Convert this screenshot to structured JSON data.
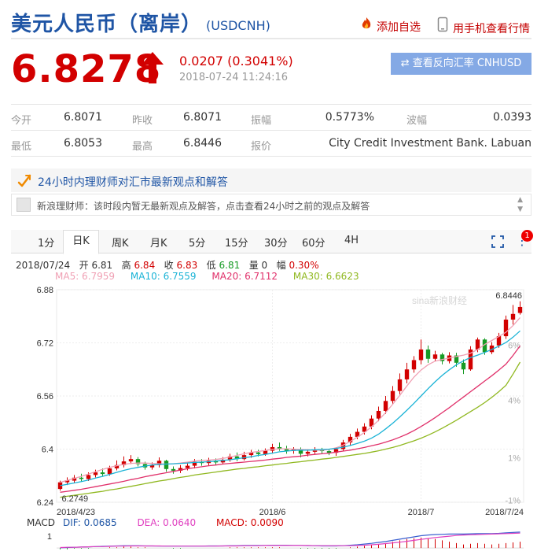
{
  "header": {
    "title": "美元人民币（离岸）",
    "symbol": "(USDCNH)",
    "add_favorite": "添加自选",
    "mobile_view": "用手机查看行情"
  },
  "quote": {
    "price": "6.8278",
    "change": "0.0207 (0.3041%)",
    "time": "2018-07-24 11:24:16",
    "reverse_button": "⇄ 查看反向汇率 CNHUSD"
  },
  "stats": {
    "open_label": "今开",
    "open": "6.8071",
    "prev_close_label": "昨收",
    "prev_close": "6.8071",
    "amplitude_label": "振幅",
    "amplitude": "0.5773%",
    "wave_label": "波幅",
    "wave": "0.0393",
    "low_label": "最低",
    "low": "6.8053",
    "high_label": "最高",
    "high": "6.8446",
    "quote_label": "报价",
    "quote_source": "City Credit Investment Bank. Labuan"
  },
  "advisor": {
    "headline": "24小时内理财师对汇市最新观点和解答",
    "message": "新浪理财师：该时段内暂无最新观点及解答，点击查看24小时之前的观点及解答"
  },
  "tabs": [
    "1分",
    "日K",
    "周K",
    "月K",
    "5分",
    "15分",
    "30分",
    "60分",
    "4H"
  ],
  "active_tab": "日K",
  "notification_count": "1",
  "bar_info": {
    "date": "2018/07/24",
    "open_label": "开",
    "open": "6.81",
    "high_label": "高",
    "high": "6.84",
    "close_label": "收",
    "close": "6.83",
    "low_label": "低",
    "low": "6.81",
    "volume_label": "量",
    "volume": "0",
    "range_label": "幅",
    "range": "0.30%"
  },
  "ma": {
    "ma5": "MA5: 6.7959",
    "ma10": "MA10: 6.7559",
    "ma20": "MA20: 6.7112",
    "ma30": "MA30: 6.6623"
  },
  "macd": {
    "label": "MACD",
    "dif": "DIF: 0.0685",
    "dea": "DEA: 0.0640",
    "macd": "MACD: 0.0090",
    "axis_label": "1"
  },
  "watermark": "sina新浪财经",
  "colors": {
    "up": "#d20000",
    "down": "#179b25",
    "ma5": "#f0a0b4",
    "ma10": "#1ab3d6",
    "ma20": "#e0306a",
    "ma30": "#90b820",
    "brand": "#1f55a5"
  },
  "chart_data": {
    "type": "candlestick",
    "x_tick_labels": [
      "2018/4/23",
      "2018/6",
      "2018/7",
      "2018/7/24"
    ],
    "y_tick_labels": [
      "6.88",
      "6.72",
      "6.56",
      "6.4",
      "6.24"
    ],
    "right_axis_labels": [
      "6%",
      "4%",
      "1%",
      "-1%"
    ],
    "ylim": [
      6.24,
      6.88
    ],
    "max_annotation": "6.8446",
    "min_annotation": "6.2749",
    "grid": true,
    "series": [
      {
        "name": "MA5",
        "values": [
          6.3,
          6.306,
          6.312,
          6.318,
          6.325,
          6.332,
          6.339,
          6.345,
          6.35,
          6.354,
          6.357,
          6.358,
          6.358,
          6.357,
          6.356,
          6.355,
          6.356,
          6.358,
          6.361,
          6.364,
          6.366,
          6.367,
          6.369,
          6.372,
          6.376,
          6.381,
          6.386,
          6.39,
          6.393,
          6.396,
          6.399,
          6.401,
          6.401,
          6.4,
          6.399,
          6.398,
          6.397,
          6.397,
          6.399,
          6.404,
          6.412,
          6.423,
          6.436,
          6.45,
          6.467,
          6.487,
          6.51,
          6.535,
          6.562,
          6.59,
          6.617,
          6.638,
          6.654,
          6.665,
          6.67,
          6.674,
          6.679,
          6.683,
          6.689,
          6.7,
          6.715,
          6.727,
          6.739,
          6.752,
          6.772,
          6.796
        ]
      },
      {
        "name": "MA10",
        "values": [
          6.29,
          6.294,
          6.298,
          6.302,
          6.307,
          6.313,
          6.318,
          6.324,
          6.33,
          6.336,
          6.341,
          6.345,
          6.349,
          6.352,
          6.354,
          6.355,
          6.356,
          6.357,
          6.358,
          6.36,
          6.361,
          6.362,
          6.364,
          6.366,
          6.368,
          6.371,
          6.374,
          6.377,
          6.381,
          6.384,
          6.388,
          6.392,
          6.394,
          6.396,
          6.397,
          6.397,
          6.398,
          6.399,
          6.4,
          6.402,
          6.406,
          6.411,
          6.417,
          6.424,
          6.433,
          6.445,
          6.461,
          6.478,
          6.497,
          6.517,
          6.538,
          6.56,
          6.582,
          6.603,
          6.622,
          6.639,
          6.654,
          6.666,
          6.676,
          6.683,
          6.691,
          6.7,
          6.71,
          6.721,
          6.737,
          6.756
        ]
      },
      {
        "name": "MA20",
        "values": [
          6.27,
          6.273,
          6.276,
          6.279,
          6.283,
          6.287,
          6.291,
          6.295,
          6.299,
          6.303,
          6.308,
          6.312,
          6.317,
          6.321,
          6.325,
          6.329,
          6.333,
          6.337,
          6.341,
          6.344,
          6.347,
          6.35,
          6.352,
          6.355,
          6.357,
          6.359,
          6.361,
          6.363,
          6.365,
          6.367,
          6.37,
          6.372,
          6.375,
          6.377,
          6.379,
          6.382,
          6.384,
          6.386,
          6.388,
          6.391,
          6.394,
          6.397,
          6.401,
          6.405,
          6.41,
          6.415,
          6.421,
          6.428,
          6.436,
          6.445,
          6.456,
          6.468,
          6.481,
          6.495,
          6.51,
          6.525,
          6.541,
          6.557,
          6.573,
          6.589,
          6.605,
          6.621,
          6.638,
          6.656,
          6.682,
          6.711
        ]
      },
      {
        "name": "MA30",
        "values": [
          6.255,
          6.258,
          6.261,
          6.264,
          6.267,
          6.27,
          6.273,
          6.277,
          6.28,
          6.284,
          6.288,
          6.292,
          6.296,
          6.3,
          6.304,
          6.307,
          6.311,
          6.315,
          6.318,
          6.322,
          6.325,
          6.328,
          6.331,
          6.334,
          6.337,
          6.34,
          6.342,
          6.345,
          6.347,
          6.35,
          6.352,
          6.355,
          6.357,
          6.36,
          6.362,
          6.365,
          6.367,
          6.37,
          6.372,
          6.375,
          6.378,
          6.381,
          6.384,
          6.387,
          6.391,
          6.395,
          6.4,
          6.405,
          6.411,
          6.418,
          6.425,
          6.433,
          6.442,
          6.452,
          6.463,
          6.475,
          6.487,
          6.5,
          6.513,
          6.526,
          6.54,
          6.556,
          6.573,
          6.592,
          6.626,
          6.662
        ]
      }
    ],
    "candles": [
      {
        "o": 6.28,
        "c": 6.3,
        "h": 6.305,
        "l": 6.275
      },
      {
        "o": 6.3,
        "c": 6.306,
        "h": 6.315,
        "l": 6.292
      },
      {
        "o": 6.305,
        "c": 6.314,
        "h": 6.322,
        "l": 6.298
      },
      {
        "o": 6.314,
        "c": 6.31,
        "h": 6.326,
        "l": 6.302
      },
      {
        "o": 6.31,
        "c": 6.322,
        "h": 6.33,
        "l": 6.304
      },
      {
        "o": 6.322,
        "c": 6.33,
        "h": 6.338,
        "l": 6.315
      },
      {
        "o": 6.33,
        "c": 6.325,
        "h": 6.342,
        "l": 6.318
      },
      {
        "o": 6.325,
        "c": 6.342,
        "h": 6.35,
        "l": 6.32
      },
      {
        "o": 6.342,
        "c": 6.352,
        "h": 6.366,
        "l": 6.336
      },
      {
        "o": 6.352,
        "c": 6.363,
        "h": 6.378,
        "l": 6.345
      },
      {
        "o": 6.363,
        "c": 6.37,
        "h": 6.382,
        "l": 6.355
      },
      {
        "o": 6.37,
        "c": 6.355,
        "h": 6.376,
        "l": 6.348
      },
      {
        "o": 6.355,
        "c": 6.345,
        "h": 6.362,
        "l": 6.338
      },
      {
        "o": 6.345,
        "c": 6.352,
        "h": 6.36,
        "l": 6.338
      },
      {
        "o": 6.352,
        "c": 6.365,
        "h": 6.375,
        "l": 6.345
      },
      {
        "o": 6.365,
        "c": 6.34,
        "h": 6.368,
        "l": 6.332
      },
      {
        "o": 6.34,
        "c": 6.335,
        "h": 6.348,
        "l": 6.326
      },
      {
        "o": 6.335,
        "c": 6.343,
        "h": 6.352,
        "l": 6.328
      },
      {
        "o": 6.343,
        "c": 6.35,
        "h": 6.36,
        "l": 6.336
      },
      {
        "o": 6.35,
        "c": 6.362,
        "h": 6.37,
        "l": 6.342
      },
      {
        "o": 6.362,
        "c": 6.358,
        "h": 6.37,
        "l": 6.35
      },
      {
        "o": 6.358,
        "c": 6.365,
        "h": 6.374,
        "l": 6.35
      },
      {
        "o": 6.365,
        "c": 6.36,
        "h": 6.372,
        "l": 6.352
      },
      {
        "o": 6.36,
        "c": 6.368,
        "h": 6.376,
        "l": 6.354
      },
      {
        "o": 6.368,
        "c": 6.378,
        "h": 6.386,
        "l": 6.362
      },
      {
        "o": 6.378,
        "c": 6.37,
        "h": 6.39,
        "l": 6.364
      },
      {
        "o": 6.37,
        "c": 6.382,
        "h": 6.392,
        "l": 6.366
      },
      {
        "o": 6.382,
        "c": 6.39,
        "h": 6.398,
        "l": 6.374
      },
      {
        "o": 6.39,
        "c": 6.385,
        "h": 6.398,
        "l": 6.378
      },
      {
        "o": 6.385,
        "c": 6.395,
        "h": 6.402,
        "l": 6.38
      },
      {
        "o": 6.395,
        "c": 6.406,
        "h": 6.416,
        "l": 6.388
      },
      {
        "o": 6.406,
        "c": 6.402,
        "h": 6.42,
        "l": 6.395
      },
      {
        "o": 6.402,
        "c": 6.395,
        "h": 6.41,
        "l": 6.386
      },
      {
        "o": 6.395,
        "c": 6.399,
        "h": 6.406,
        "l": 6.386
      },
      {
        "o": 6.399,
        "c": 6.386,
        "h": 6.405,
        "l": 6.375
      },
      {
        "o": 6.386,
        "c": 6.392,
        "h": 6.4,
        "l": 6.378
      },
      {
        "o": 6.392,
        "c": 6.398,
        "h": 6.406,
        "l": 6.384
      },
      {
        "o": 6.398,
        "c": 6.394,
        "h": 6.404,
        "l": 6.385
      },
      {
        "o": 6.394,
        "c": 6.389,
        "h": 6.4,
        "l": 6.382
      },
      {
        "o": 6.389,
        "c": 6.4,
        "h": 6.406,
        "l": 6.38
      },
      {
        "o": 6.4,
        "c": 6.42,
        "h": 6.428,
        "l": 6.394
      },
      {
        "o": 6.42,
        "c": 6.437,
        "h": 6.446,
        "l": 6.412
      },
      {
        "o": 6.437,
        "c": 6.452,
        "h": 6.462,
        "l": 6.43
      },
      {
        "o": 6.452,
        "c": 6.468,
        "h": 6.478,
        "l": 6.444
      },
      {
        "o": 6.468,
        "c": 6.492,
        "h": 6.502,
        "l": 6.46
      },
      {
        "o": 6.492,
        "c": 6.515,
        "h": 6.528,
        "l": 6.484
      },
      {
        "o": 6.515,
        "c": 6.545,
        "h": 6.56,
        "l": 6.506
      },
      {
        "o": 6.545,
        "c": 6.575,
        "h": 6.59,
        "l": 6.535
      },
      {
        "o": 6.575,
        "c": 6.61,
        "h": 6.628,
        "l": 6.565
      },
      {
        "o": 6.61,
        "c": 6.64,
        "h": 6.66,
        "l": 6.598
      },
      {
        "o": 6.64,
        "c": 6.668,
        "h": 6.68,
        "l": 6.63
      },
      {
        "o": 6.668,
        "c": 6.7,
        "h": 6.73,
        "l": 6.655
      },
      {
        "o": 6.7,
        "c": 6.672,
        "h": 6.712,
        "l": 6.66
      },
      {
        "o": 6.672,
        "c": 6.685,
        "h": 6.696,
        "l": 6.664
      },
      {
        "o": 6.685,
        "c": 6.665,
        "h": 6.69,
        "l": 6.655
      },
      {
        "o": 6.665,
        "c": 6.682,
        "h": 6.692,
        "l": 6.658
      },
      {
        "o": 6.682,
        "c": 6.66,
        "h": 6.69,
        "l": 6.648
      },
      {
        "o": 6.66,
        "c": 6.64,
        "h": 6.67,
        "l": 6.626
      },
      {
        "o": 6.64,
        "c": 6.7,
        "h": 6.71,
        "l": 6.636
      },
      {
        "o": 6.7,
        "c": 6.73,
        "h": 6.736,
        "l": 6.692
      },
      {
        "o": 6.73,
        "c": 6.692,
        "h": 6.734,
        "l": 6.684
      },
      {
        "o": 6.692,
        "c": 6.712,
        "h": 6.722,
        "l": 6.686
      },
      {
        "o": 6.712,
        "c": 6.74,
        "h": 6.75,
        "l": 6.705
      },
      {
        "o": 6.74,
        "c": 6.79,
        "h": 6.802,
        "l": 6.732
      },
      {
        "o": 6.79,
        "c": 6.807,
        "h": 6.834,
        "l": 6.775
      },
      {
        "o": 6.81,
        "c": 6.828,
        "h": 6.845,
        "l": 6.805
      }
    ],
    "macd_histogram": [
      -0.002,
      -0.002,
      -0.001,
      -0.001,
      -0.001,
      0.0,
      0.0,
      0.001,
      0.001,
      0.002,
      0.002,
      0.001,
      0.001,
      0.0,
      0.0,
      0.0,
      -0.001,
      -0.001,
      0.0,
      0.0,
      0.0,
      0.0,
      0.0,
      0.0,
      0.001,
      0.001,
      0.001,
      0.001,
      0.001,
      0.001,
      0.001,
      0.001,
      0.0,
      0.0,
      -0.001,
      -0.001,
      -0.001,
      -0.001,
      -0.001,
      -0.001,
      0.0,
      0.001,
      0.002,
      0.003,
      0.004,
      0.005,
      0.007,
      0.009,
      0.011,
      0.013,
      0.014,
      0.015,
      0.014,
      0.013,
      0.011,
      0.009,
      0.007,
      0.005,
      0.006,
      0.007,
      0.006,
      0.005,
      0.006,
      0.007,
      0.008,
      0.009
    ],
    "dif": [
      0.001,
      0.002,
      0.003,
      0.004,
      0.005,
      0.006,
      0.007,
      0.008,
      0.009,
      0.01,
      0.01,
      0.01,
      0.009,
      0.009,
      0.008,
      0.008,
      0.008,
      0.008,
      0.008,
      0.008,
      0.008,
      0.009,
      0.009,
      0.009,
      0.01,
      0.01,
      0.011,
      0.011,
      0.011,
      0.011,
      0.012,
      0.012,
      0.012,
      0.011,
      0.011,
      0.01,
      0.01,
      0.009,
      0.009,
      0.009,
      0.01,
      0.012,
      0.014,
      0.017,
      0.02,
      0.024,
      0.028,
      0.033,
      0.038,
      0.043,
      0.048,
      0.053,
      0.056,
      0.058,
      0.059,
      0.06,
      0.06,
      0.06,
      0.061,
      0.062,
      0.062,
      0.062,
      0.063,
      0.065,
      0.067,
      0.0685
    ],
    "dea": [
      0.002,
      0.003,
      0.003,
      0.004,
      0.005,
      0.006,
      0.006,
      0.007,
      0.008,
      0.008,
      0.009,
      0.009,
      0.009,
      0.009,
      0.009,
      0.008,
      0.008,
      0.008,
      0.008,
      0.008,
      0.008,
      0.008,
      0.008,
      0.009,
      0.009,
      0.009,
      0.01,
      0.01,
      0.01,
      0.011,
      0.011,
      0.011,
      0.011,
      0.011,
      0.011,
      0.011,
      0.01,
      0.01,
      0.01,
      0.01,
      0.01,
      0.01,
      0.011,
      0.012,
      0.014,
      0.016,
      0.019,
      0.022,
      0.025,
      0.029,
      0.033,
      0.037,
      0.041,
      0.045,
      0.048,
      0.051,
      0.054,
      0.056,
      0.057,
      0.058,
      0.059,
      0.06,
      0.061,
      0.062,
      0.063,
      0.064
    ]
  }
}
